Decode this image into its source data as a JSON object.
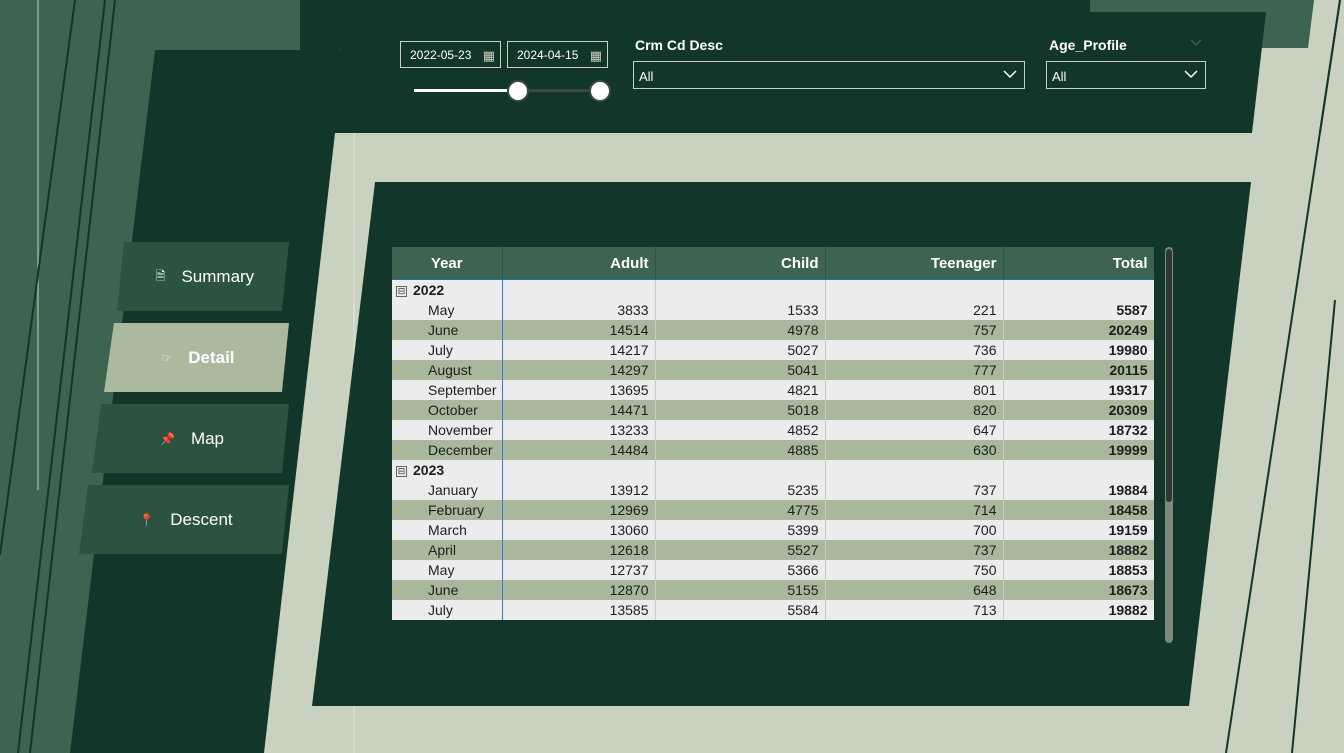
{
  "colors": {
    "dark_green": "#123629",
    "mid_green": "#3c6450",
    "sage": "#c8d2be",
    "row_band": "#a9b89c",
    "row_light": "#ececec"
  },
  "filters": {
    "date_start": "2022-05-23",
    "date_end": "2024-04-15",
    "date_range_fill_fraction": [
      0.0,
      1.0
    ],
    "calendar_icon": "calendar-icon",
    "crime_title": "Crm Cd Desc",
    "crime_value": "All",
    "age_title": "Age_Profile",
    "age_value": "All"
  },
  "nav": [
    {
      "label": "Summary",
      "icon": "document-icon",
      "active": false
    },
    {
      "label": "Detail",
      "icon": "pointing-hand-icon",
      "active": true
    },
    {
      "label": "Map",
      "icon": "pushpin-icon",
      "active": false
    },
    {
      "label": "Descent",
      "icon": "pin-icon",
      "active": false
    }
  ],
  "table": {
    "headers": [
      "Year",
      "Adult",
      "Child",
      "Teenager",
      "Total"
    ],
    "rows": [
      {
        "type": "group",
        "label": "2022",
        "expand_symbol": "⊟"
      },
      {
        "type": "data",
        "label": "May",
        "adult": "3833",
        "child": "1533",
        "teen": "221",
        "total": "5587"
      },
      {
        "type": "data",
        "label": "June",
        "adult": "14514",
        "child": "4978",
        "teen": "757",
        "total": "20249"
      },
      {
        "type": "data",
        "label": "July",
        "adult": "14217",
        "child": "5027",
        "teen": "736",
        "total": "19980"
      },
      {
        "type": "data",
        "label": "August",
        "adult": "14297",
        "child": "5041",
        "teen": "777",
        "total": "20115"
      },
      {
        "type": "data",
        "label": "September",
        "adult": "13695",
        "child": "4821",
        "teen": "801",
        "total": "19317"
      },
      {
        "type": "data",
        "label": "October",
        "adult": "14471",
        "child": "5018",
        "teen": "820",
        "total": "20309"
      },
      {
        "type": "data",
        "label": "November",
        "adult": "13233",
        "child": "4852",
        "teen": "647",
        "total": "18732"
      },
      {
        "type": "data",
        "label": "December",
        "adult": "14484",
        "child": "4885",
        "teen": "630",
        "total": "19999"
      },
      {
        "type": "group",
        "label": "2023",
        "expand_symbol": "⊟"
      },
      {
        "type": "data",
        "label": "January",
        "adult": "13912",
        "child": "5235",
        "teen": "737",
        "total": "19884"
      },
      {
        "type": "data",
        "label": "February",
        "adult": "12969",
        "child": "4775",
        "teen": "714",
        "total": "18458"
      },
      {
        "type": "data",
        "label": "March",
        "adult": "13060",
        "child": "5399",
        "teen": "700",
        "total": "19159"
      },
      {
        "type": "data",
        "label": "April",
        "adult": "12618",
        "child": "5527",
        "teen": "737",
        "total": "18882"
      },
      {
        "type": "data",
        "label": "May",
        "adult": "12737",
        "child": "5366",
        "teen": "750",
        "total": "18853"
      },
      {
        "type": "data",
        "label": "June",
        "adult": "12870",
        "child": "5155",
        "teen": "648",
        "total": "18673"
      },
      {
        "type": "data",
        "label": "July",
        "adult": "13585",
        "child": "5584",
        "teen": "713",
        "total": "19882"
      }
    ]
  }
}
